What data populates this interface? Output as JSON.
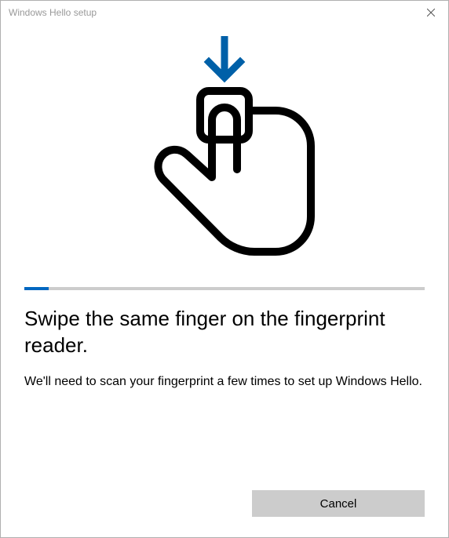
{
  "titlebar": {
    "title": "Windows Hello setup"
  },
  "progress": {
    "percent": 6
  },
  "heading": "Swipe the same finger on the fingerprint reader.",
  "body": "We'll need to scan your fingerprint a few times to set up Windows Hello.",
  "footer": {
    "cancel_label": "Cancel"
  }
}
